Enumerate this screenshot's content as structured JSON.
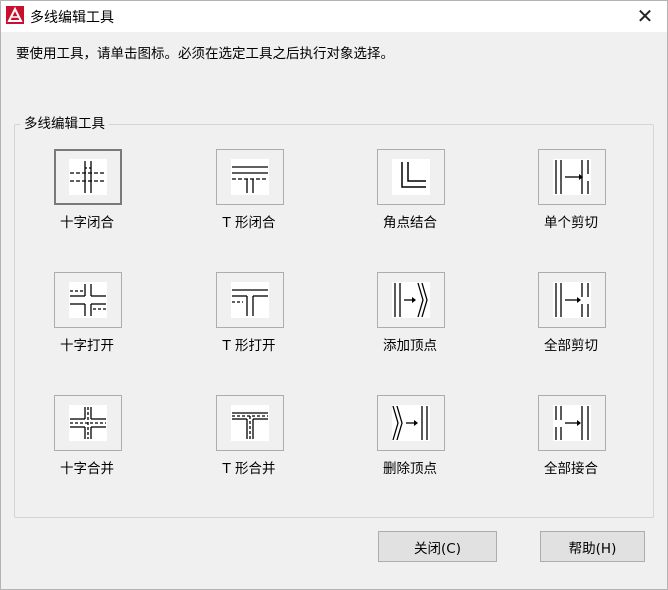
{
  "window": {
    "title": "多线编辑工具",
    "close_symbol": "✕"
  },
  "instruction": "要使用工具，请单击图标。必须在选定工具之后执行对象选择。",
  "group": {
    "label": "多线编辑工具"
  },
  "tools": [
    {
      "label": "十字闭合",
      "icon": "closed-cross-icon",
      "selected": true
    },
    {
      "label": "T 形闭合",
      "icon": "closed-tee-icon"
    },
    {
      "label": "角点结合",
      "icon": "corner-joint-icon"
    },
    {
      "label": "单个剪切",
      "icon": "cut-single-icon"
    },
    {
      "label": "十字打开",
      "icon": "open-cross-icon"
    },
    {
      "label": "T 形打开",
      "icon": "open-tee-icon"
    },
    {
      "label": "添加顶点",
      "icon": "add-vertex-icon"
    },
    {
      "label": "全部剪切",
      "icon": "cut-all-icon"
    },
    {
      "label": "十字合并",
      "icon": "merged-cross-icon"
    },
    {
      "label": "T 形合并",
      "icon": "merged-tee-icon"
    },
    {
      "label": "删除顶点",
      "icon": "delete-vertex-icon"
    },
    {
      "label": "全部接合",
      "icon": "weld-all-icon"
    }
  ],
  "buttons": {
    "close_label": "关闭(C)",
    "help_label": "帮助(H)"
  }
}
